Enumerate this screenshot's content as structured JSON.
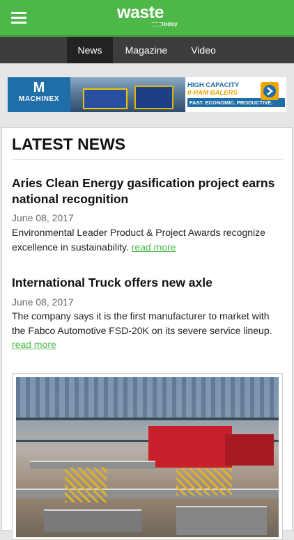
{
  "header": {
    "logo_main": "waste",
    "logo_sub": "today"
  },
  "nav": {
    "tabs": [
      {
        "label": "News",
        "active": true
      },
      {
        "label": "Magazine",
        "active": false
      },
      {
        "label": "Video",
        "active": false
      }
    ]
  },
  "ad": {
    "brand": "MACHINEX",
    "logo_letter": "M",
    "line1": "HIGH CAPACITY",
    "line2": "II-RAM BALERS",
    "line3": "FAST. ECONOMIC. PRODUCTIVE."
  },
  "latest": {
    "title": "LATEST NEWS",
    "articles": [
      {
        "headline": "Aries Clean Energy gasification project earns national recognition",
        "date": "June 08, 2017",
        "summary": "Environmental Leader Product & Project Awards recognize excellence in sustainability.",
        "link": "read more"
      },
      {
        "headline": "International Truck offers new axle",
        "date": "June 08, 2017",
        "summary": "The company says it is the first manufacturer to market with the Fabco Automotive FSD-20K on its severe service lineup.",
        "link": "read more"
      }
    ]
  },
  "colors": {
    "brand_green": "#4db848",
    "nav_dark": "#3d3d3d",
    "ad_blue": "#1f6ea8",
    "ad_orange": "#f1a500"
  }
}
